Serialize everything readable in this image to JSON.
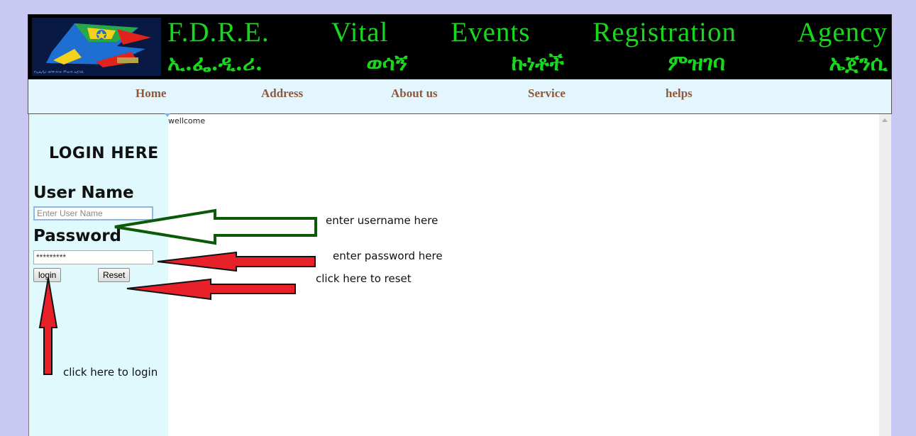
{
  "banner": {
    "title": "F.D.R.E. Vital Events Registration Agency",
    "subtitle_words": [
      "ኢ.ፌ.ዲ.ሪ.",
      "ወሳኝ",
      "ኩነቶች",
      "ምዝገባ",
      "ኤጀንሲ"
    ],
    "logo_small_text": "የኢፌዲሪ ወሳኝ ኩነት ምዝገባ ኤጀንሲ"
  },
  "nav": {
    "items": [
      {
        "label": "Home"
      },
      {
        "label": "Address"
      },
      {
        "label": "About us"
      },
      {
        "label": "Service"
      },
      {
        "label": "helps"
      }
    ]
  },
  "content": {
    "welcome": "wellcome"
  },
  "login": {
    "title": "LOGIN HERE",
    "username_label": "User Name",
    "username_placeholder": "Enter User Name",
    "password_label": "Password",
    "password_value": "*********",
    "login_button": "login",
    "reset_button": "Reset"
  },
  "annotations": {
    "username": "enter username here",
    "password": "enter password here",
    "reset": "click here to reset",
    "login": "click here to login"
  },
  "colors": {
    "page_bg": "#c9c8f2",
    "banner_text": "#17d81c",
    "nav_text": "#8b5a3c",
    "sidebar_bg": "#dff9fd",
    "arrow_green": "#0a5a0a",
    "arrow_red": "#e8202a"
  },
  "icons": [
    "agency-logo-icon",
    "flag-emblem-icon",
    "scroll-up-icon",
    "arrow-icons"
  ]
}
